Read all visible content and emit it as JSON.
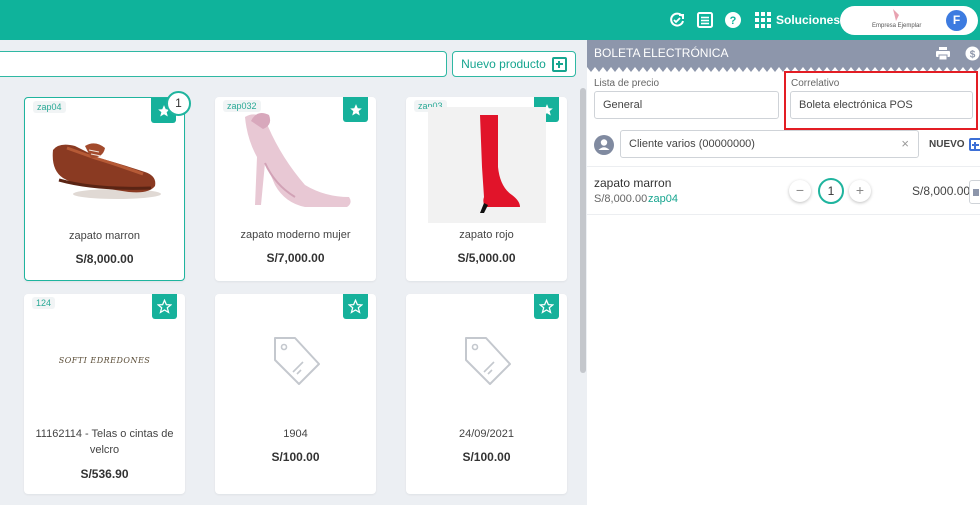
{
  "topbar": {
    "color": "#0fb39b",
    "icons": [
      "refresh-icon",
      "list-icon",
      "help-icon"
    ],
    "solutions_label": "Soluciones",
    "company_name": "Empresa Ejemplar",
    "avatar_letter": "F"
  },
  "toolbar": {
    "search_value": "",
    "new_product_label": "Nuevo producto"
  },
  "products": [
    {
      "code": "zap04",
      "name": "zapato marron",
      "price": "S/8,000.00",
      "favorite": true,
      "selected": true,
      "count": "1"
    },
    {
      "code": "zap032",
      "name": "zapato moderno mujer",
      "price": "S/7,000.00",
      "favorite": true
    },
    {
      "code": "zap03",
      "name": "zapato rojo",
      "price": "S/5,000.00",
      "favorite": true
    },
    {
      "code": "124",
      "name": "11162114 - Telas o cintas de velcro",
      "price": "S/536.90",
      "favorite": false,
      "image_text": "SOFTI EDREDONES"
    },
    {
      "code": "",
      "name": "1904",
      "price": "S/100.00",
      "favorite": false
    },
    {
      "code": "",
      "name": "24/09/2021",
      "price": "S/100.00",
      "favorite": false
    }
  ],
  "receipt": {
    "title": "BOLETA ELECTRÓNICA",
    "price_list_label": "Lista de precio",
    "price_list_value": "General",
    "correlative_label": "Correlativo",
    "correlative_value": "Boleta electrónica POS",
    "client_value": "Cliente varios (00000000)",
    "new_client_label": "NUEVO",
    "items": [
      {
        "name": "zapato marron",
        "unit_price": "S/8,000.00",
        "code": "zap04",
        "qty": "1",
        "total": "S/8,000.00"
      }
    ]
  }
}
